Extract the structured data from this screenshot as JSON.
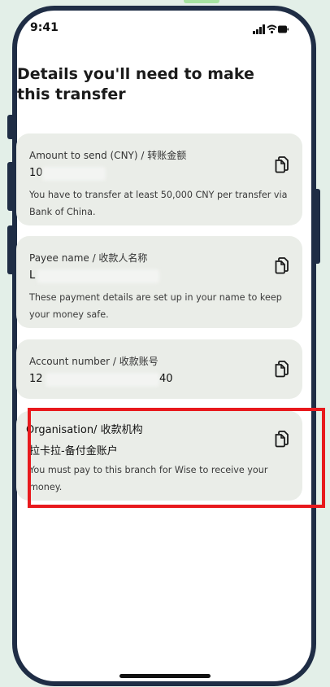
{
  "status_bar": {
    "time": "9:41"
  },
  "page": {
    "title": "Details you'll need to make this transfer"
  },
  "cards": [
    {
      "label": "Amount to send (CNY) / 转账金额",
      "value": "10",
      "value_tail": "",
      "note": "You have to transfer at least 50,000 CNY per transfer via Bank of China."
    },
    {
      "label": "Payee name / 收款人名称",
      "value": "L",
      "value_tail": "",
      "note": "These payment details are set up in your name to keep your money safe."
    },
    {
      "label": "Account number / 收款账号",
      "value": "12",
      "value_tail": "40",
      "note": ""
    },
    {
      "label": "Organisation/ 收款机构",
      "value": "拉卡拉-备付金账户",
      "value_tail": "",
      "note": "You must pay to this branch for Wise to receive your money."
    }
  ],
  "icons": {
    "copy": "copy-icon",
    "signal": "signal-icon",
    "wifi": "wifi-icon",
    "battery": "battery-icon"
  },
  "colors": {
    "highlight": "#e8191d",
    "card_bg": "#eaede8",
    "frame": "#1f2d45"
  }
}
